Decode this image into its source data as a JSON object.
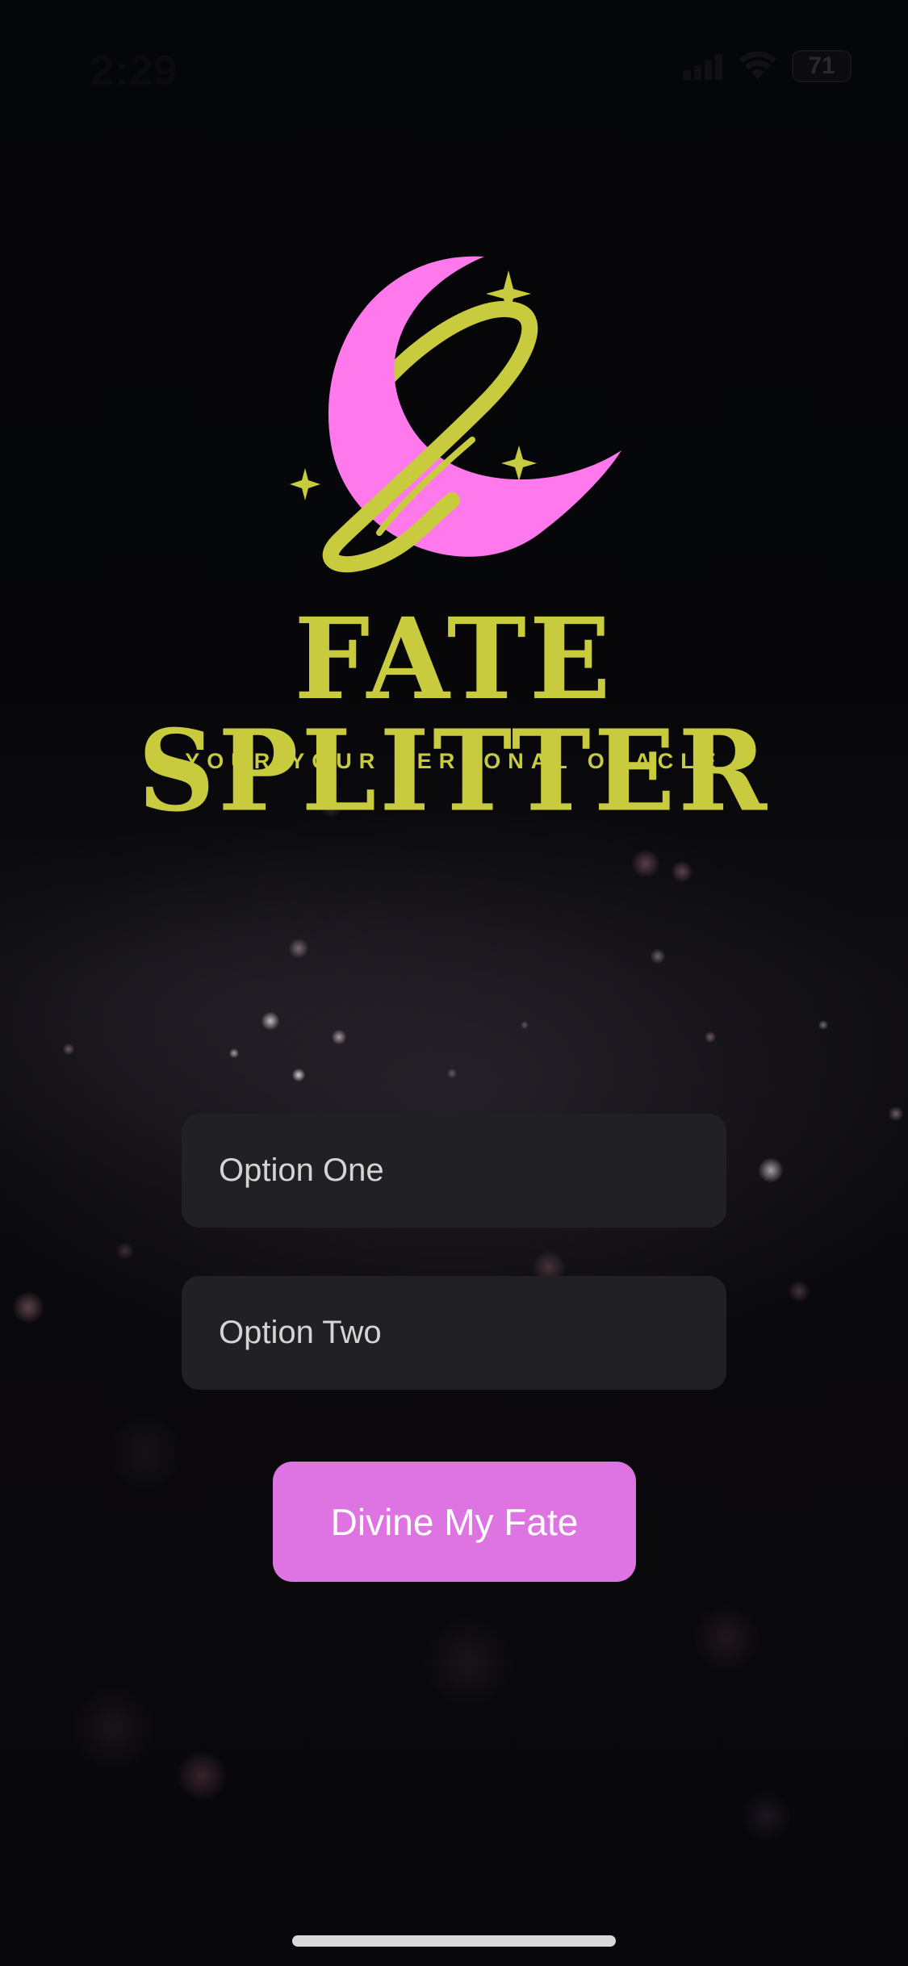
{
  "status_bar": {
    "time": "2:29",
    "battery_level": "71",
    "icons": [
      "signal-icon",
      "wifi-icon",
      "battery-icon"
    ]
  },
  "brand": {
    "logo_icon": "moon-planet-stars-logo",
    "title": "FATE SPLITTER",
    "tagline": "YOUR YOUR PERSONAL ORACLE",
    "colors": {
      "moon": "#ff78ec",
      "accent": "#c9cb3e"
    }
  },
  "form": {
    "option_one_placeholder": "Option One",
    "option_one_value": "",
    "option_two_placeholder": "Option Two",
    "option_two_value": "",
    "submit_label": "Divine My Fate",
    "button_color": "#de74e2",
    "field_color": "#212123"
  }
}
